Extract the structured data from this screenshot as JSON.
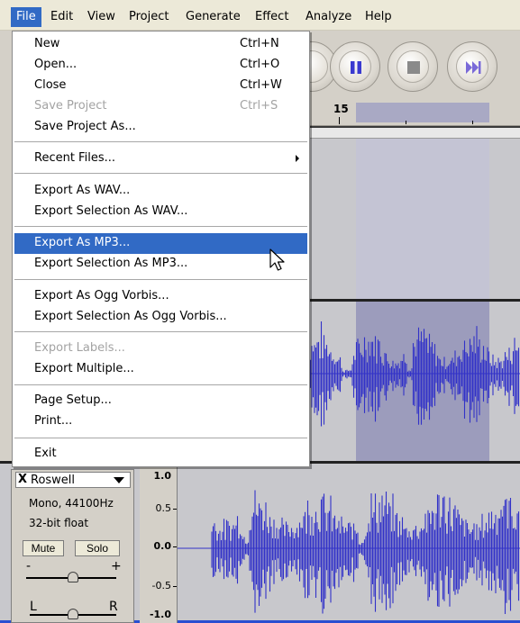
{
  "menubar": {
    "items": [
      {
        "label": "File"
      },
      {
        "label": "Edit"
      },
      {
        "label": "View"
      },
      {
        "label": "Project"
      },
      {
        "label": "Generate"
      },
      {
        "label": "Effect"
      },
      {
        "label": "Analyze"
      },
      {
        "label": "Help"
      }
    ]
  },
  "file_menu": {
    "new": {
      "label": "New",
      "shortcut": "Ctrl+N"
    },
    "open": {
      "label": "Open...",
      "shortcut": "Ctrl+O"
    },
    "close": {
      "label": "Close",
      "shortcut": "Ctrl+W"
    },
    "save_project": {
      "label": "Save Project",
      "shortcut": "Ctrl+S",
      "enabled": false
    },
    "save_project_as": {
      "label": "Save Project As..."
    },
    "recent_files": {
      "label": "Recent Files..."
    },
    "export_wav": {
      "label": "Export As WAV..."
    },
    "export_selection_wav": {
      "label": "Export Selection As WAV..."
    },
    "export_mp3": {
      "label": "Export As MP3...",
      "highlighted": true
    },
    "export_selection_mp3": {
      "label": "Export Selection As MP3..."
    },
    "export_ogg": {
      "label": "Export As Ogg Vorbis..."
    },
    "export_selection_ogg": {
      "label": "Export Selection As Ogg Vorbis..."
    },
    "export_labels": {
      "label": "Export Labels...",
      "enabled": false
    },
    "export_multiple": {
      "label": "Export Multiple..."
    },
    "page_setup": {
      "label": "Page Setup..."
    },
    "print": {
      "label": "Print..."
    },
    "exit": {
      "label": "Exit"
    }
  },
  "timeline": {
    "tick_label": "15"
  },
  "track": {
    "close_label": "X",
    "name": "Roswell",
    "channels": "Mono, 44100Hz",
    "format": "32-bit float",
    "mute_label": "Mute",
    "solo_label": "Solo",
    "gain_minus": "-",
    "gain_plus": "+",
    "pan_left": "L",
    "pan_right": "R",
    "scale": [
      "1.0",
      "0.5",
      "0.0",
      "-0.5",
      "-1.0"
    ]
  },
  "colors": {
    "menu_highlight": "#316ac5",
    "waveform": "#3232c8",
    "selection": "#9c9cbc",
    "desktop": "#2a4fd1"
  },
  "icons": {
    "pause": "pause-icon",
    "stop": "stop-icon",
    "skip_end": "skip-to-end-icon",
    "submenu": "submenu-arrow-icon",
    "cursor": "mouse-pointer-icon"
  }
}
